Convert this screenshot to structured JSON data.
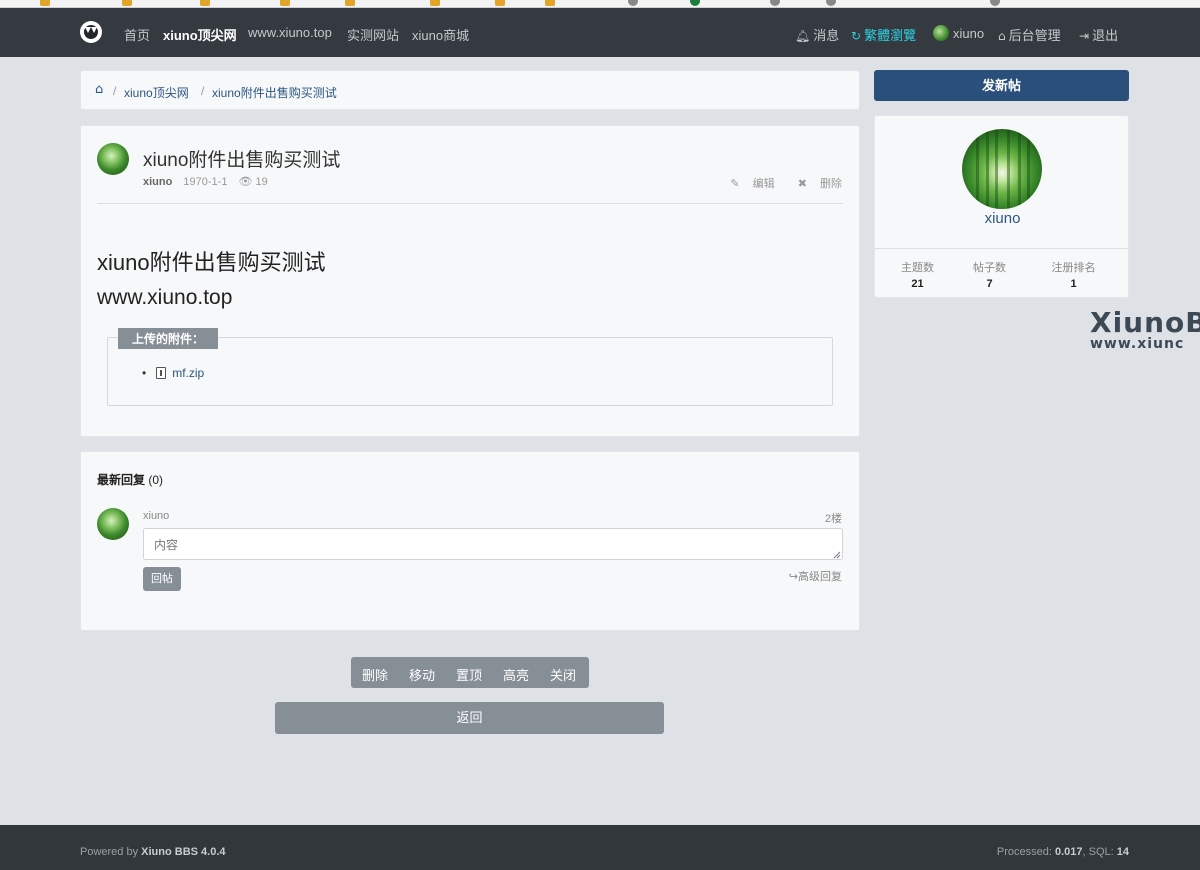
{
  "navbar": {
    "links": [
      "首页",
      "xiuno顶尖网",
      "www.xiuno.top",
      "实测网站",
      "xiuno商城"
    ],
    "right": {
      "messages": "消息",
      "traditional": "繁體瀏覽",
      "username": "xiuno",
      "admin": "后台管理",
      "logout": "退出"
    }
  },
  "breadcrumb": {
    "items": [
      "xiuno顶尖网",
      "xiuno附件出售购买测试"
    ],
    "separator": "/"
  },
  "post": {
    "title": "xiuno附件出售购买测试",
    "author": "xiuno",
    "date": "1970-1-1",
    "views": "19",
    "edit_label": "编辑",
    "delete_label": "删除",
    "content_heading": "xiuno附件出售购买测试",
    "content_url": "www.xiuno.top",
    "attachments_label": "上传的附件：",
    "attachments": [
      "mf.zip"
    ]
  },
  "replies": {
    "heading": "最新回复",
    "count": "(0)",
    "user": "xiuno",
    "floor": "2楼",
    "placeholder": "内容",
    "submit_label": "回帖",
    "advanced_label": "高级回复"
  },
  "moderation": {
    "buttons": [
      "删除",
      "移动",
      "置顶",
      "高亮",
      "关闭"
    ],
    "back_label": "返回"
  },
  "sidebar": {
    "new_thread_label": "发新帖",
    "user": {
      "name": "xiuno",
      "stats": [
        {
          "label": "主题数",
          "value": "21"
        },
        {
          "label": "帖子数",
          "value": "7"
        },
        {
          "label": "注册排名",
          "value": "1"
        }
      ]
    }
  },
  "watermark": {
    "title": "XiunoB",
    "subtitle": "www.xiunc"
  },
  "footer": {
    "powered_prefix": "Powered by",
    "powered_name": "Xiuno BBS 4.0.4",
    "processed_label": "Processed:",
    "processed_value": "0.017",
    "sql_label": "SQL:",
    "sql_value": "14"
  },
  "colors": {
    "nav_bg": "#343a40",
    "page_bg": "#dee2e6",
    "primary": "#2a4f7a",
    "button_gray": "#868e96",
    "link": "#2b5680",
    "accent_cyan": "#2ecfe0"
  }
}
